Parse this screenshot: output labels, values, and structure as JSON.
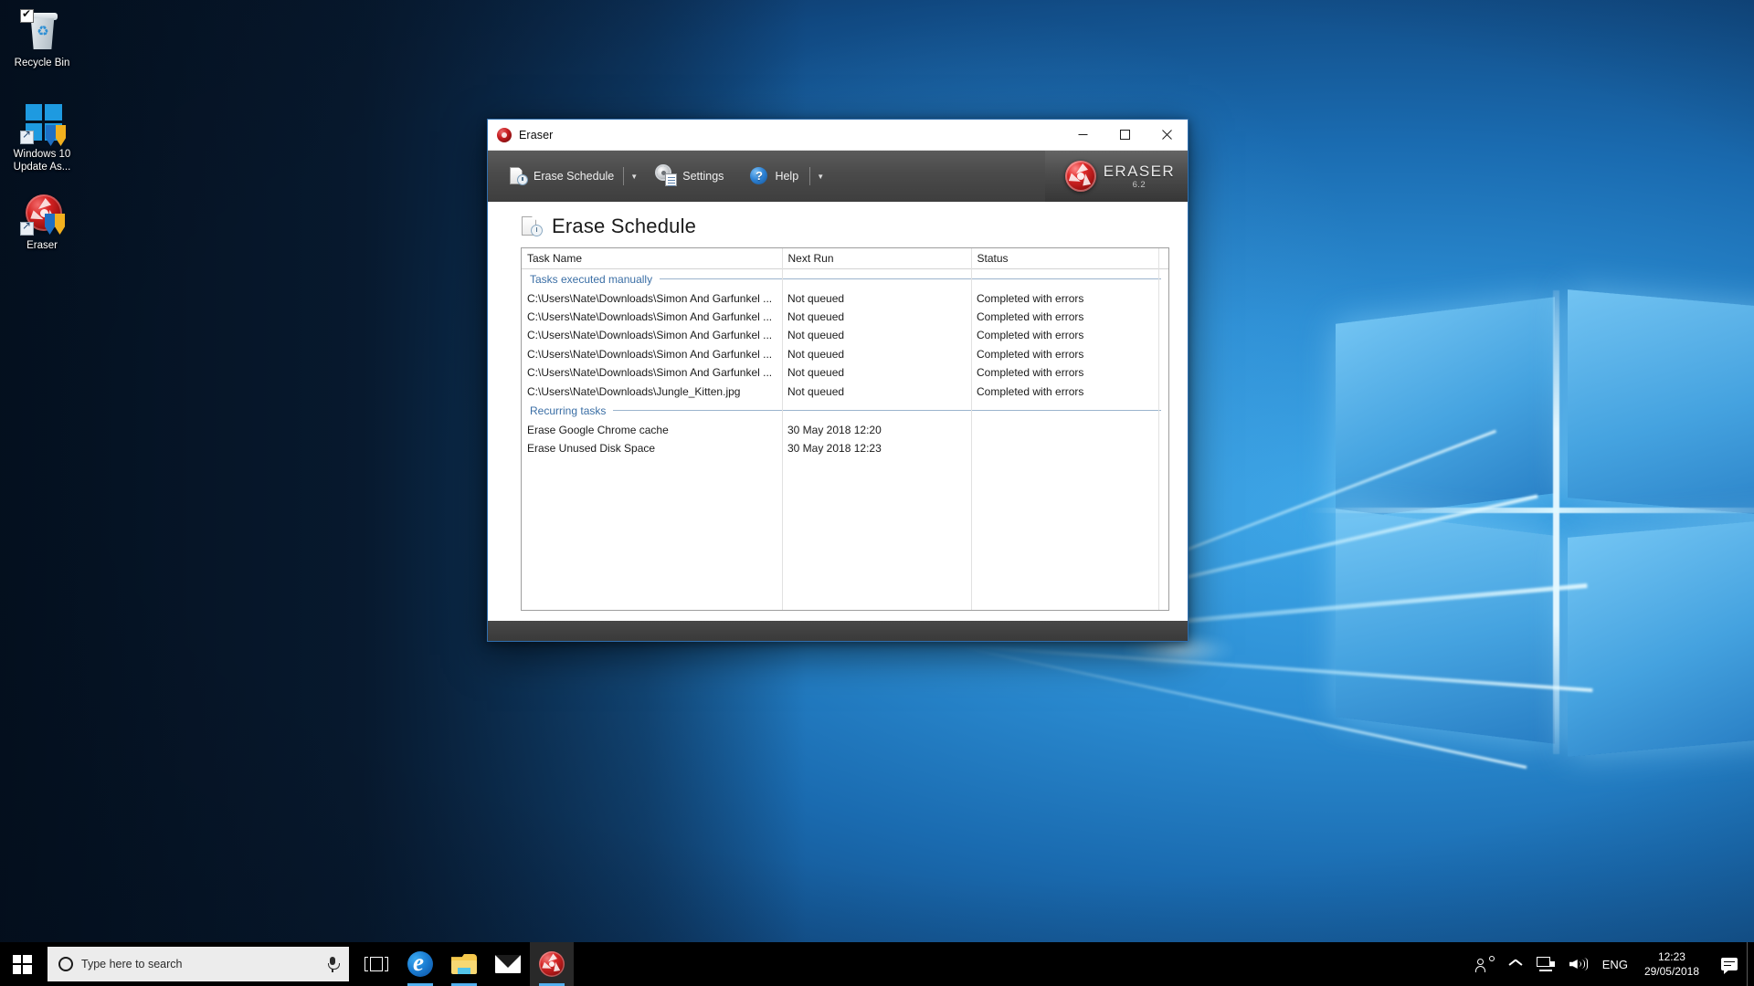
{
  "desktop": {
    "icons": [
      {
        "name": "Recycle Bin",
        "icon": "recycle-bin-icon"
      },
      {
        "name": "Windows 10 Update As...",
        "icon": "windows-update-assistant-icon"
      },
      {
        "name": "Eraser",
        "icon": "eraser-shortcut-icon"
      }
    ]
  },
  "window": {
    "title": "Eraser",
    "icon": "eraser-icon",
    "controls": {
      "minimize": "Minimize",
      "maximize": "Maximize",
      "close": "Close"
    },
    "toolbar": {
      "erase_schedule": "Erase Schedule",
      "settings": "Settings",
      "help": "Help",
      "dropdown_glyph": "▼"
    },
    "brand": {
      "name": "ERASER",
      "version": "6.2"
    },
    "page": {
      "title": "Erase Schedule",
      "icon": "erase-schedule-icon"
    }
  },
  "schedule": {
    "columns": [
      "Task Name",
      "Next Run",
      "Status",
      ""
    ],
    "groups": [
      {
        "label": "Tasks executed manually",
        "rows": [
          {
            "task": "C:\\Users\\Nate\\Downloads\\Simon And Garfunkel ...",
            "next_run": "Not queued",
            "status": "Completed with errors"
          },
          {
            "task": "C:\\Users\\Nate\\Downloads\\Simon And Garfunkel ...",
            "next_run": "Not queued",
            "status": "Completed with errors"
          },
          {
            "task": "C:\\Users\\Nate\\Downloads\\Simon And Garfunkel ...",
            "next_run": "Not queued",
            "status": "Completed with errors"
          },
          {
            "task": "C:\\Users\\Nate\\Downloads\\Simon And Garfunkel ...",
            "next_run": "Not queued",
            "status": "Completed with errors"
          },
          {
            "task": "C:\\Users\\Nate\\Downloads\\Simon And Garfunkel ...",
            "next_run": "Not queued",
            "status": "Completed with errors"
          },
          {
            "task": "C:\\Users\\Nate\\Downloads\\Jungle_Kitten.jpg",
            "next_run": "Not queued",
            "status": "Completed with errors"
          }
        ]
      },
      {
        "label": "Recurring tasks",
        "rows": [
          {
            "task": "Erase Google Chrome cache",
            "next_run": "30 May 2018 12:20",
            "status": ""
          },
          {
            "task": "Erase Unused Disk Space",
            "next_run": "30 May 2018 12:23",
            "status": ""
          }
        ]
      }
    ]
  },
  "taskbar": {
    "start": "Start",
    "search": {
      "placeholder": "Type here to search",
      "value": ""
    },
    "items": [
      {
        "name": "Task View",
        "icon": "task-view-icon"
      },
      {
        "name": "Microsoft Edge",
        "icon": "edge-icon"
      },
      {
        "name": "File Explorer",
        "icon": "file-explorer-icon"
      },
      {
        "name": "Mail",
        "icon": "mail-icon"
      },
      {
        "name": "Eraser",
        "icon": "eraser-icon"
      }
    ],
    "tray": {
      "people": "People",
      "show_hidden": "Show hidden icons",
      "network": "Network",
      "volume": "Volume",
      "language": "ENG",
      "time": "12:23",
      "date": "29/05/2018",
      "notifications": "Action Center"
    }
  },
  "colors": {
    "accent": "#52b0ef",
    "group_label": "#3a6ea5",
    "toolbar_bg": "#4b4b4b",
    "brand_red": "#d62626"
  }
}
